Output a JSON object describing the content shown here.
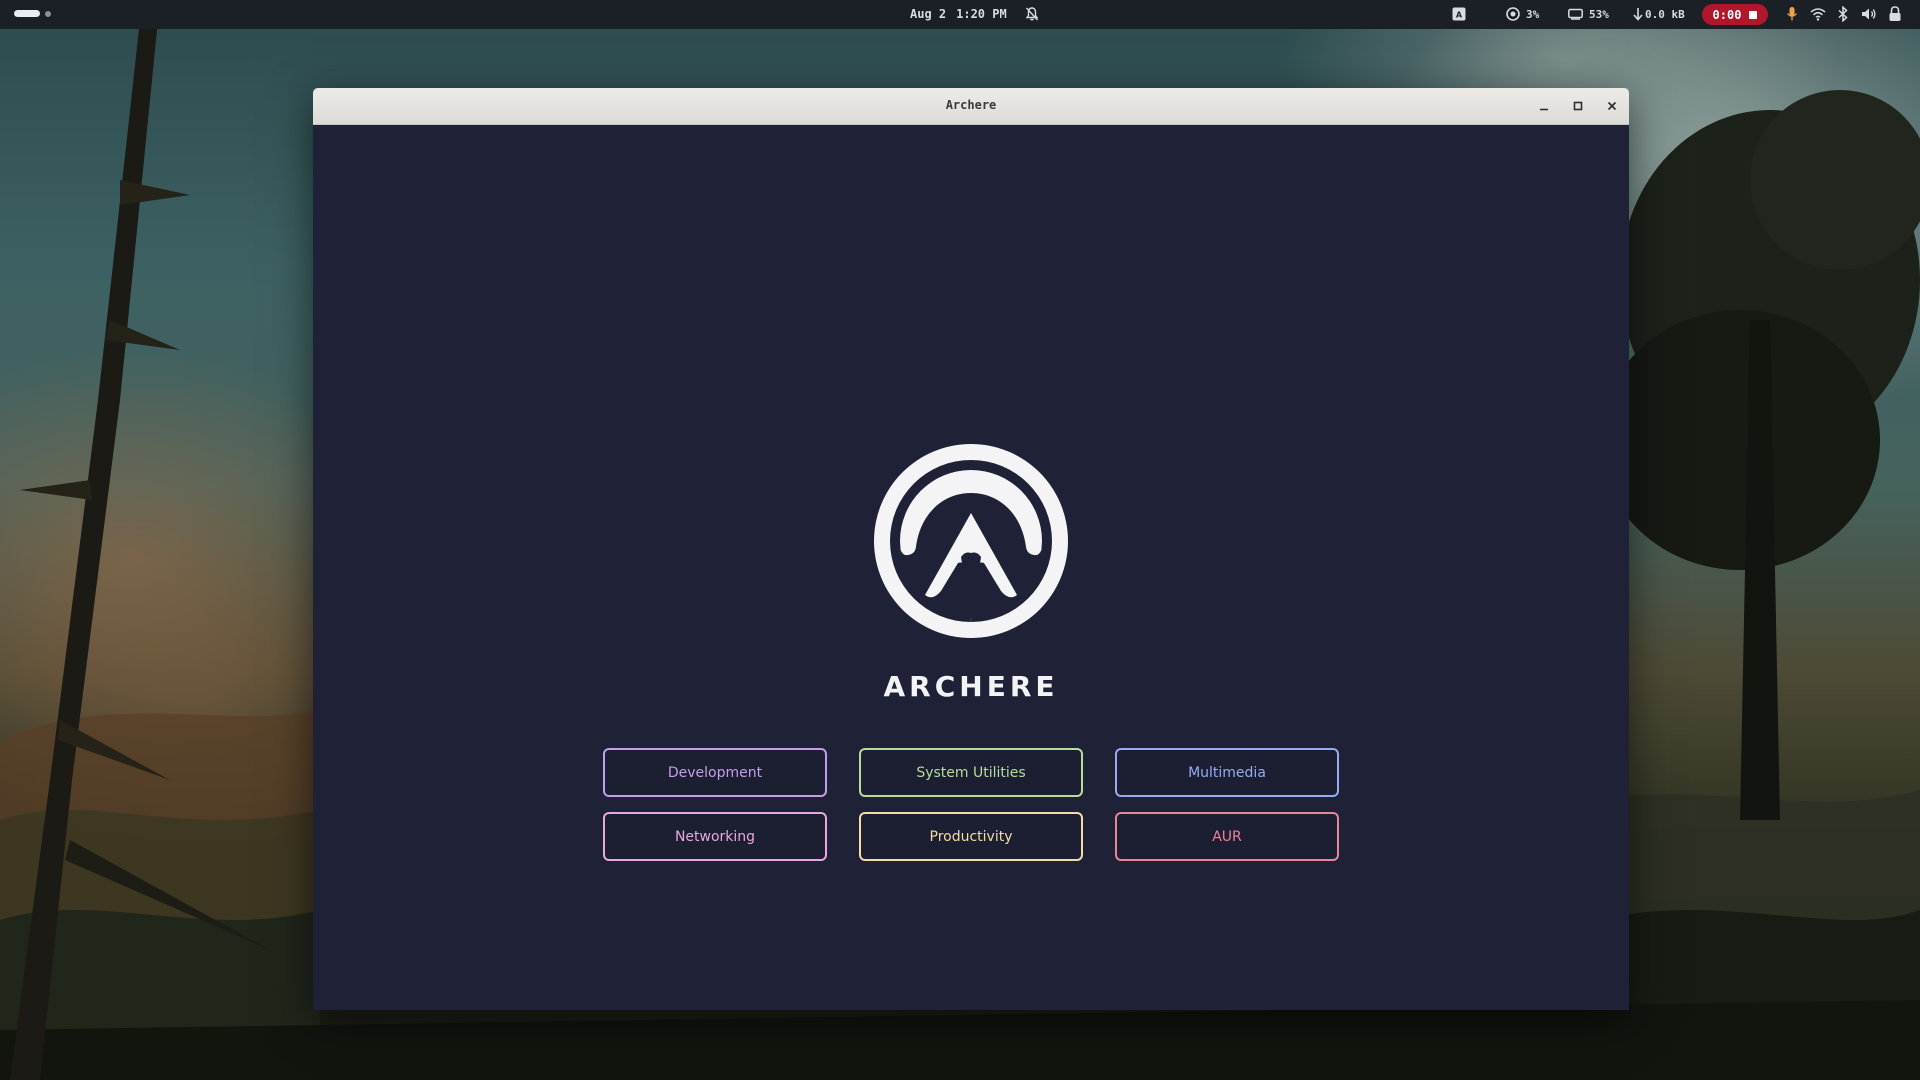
{
  "topbar": {
    "date": "Aug 2",
    "time": "1:20 PM",
    "cpu_label": "3%",
    "memory_label": "53%",
    "network_label": "0.0 kB",
    "recording_label": "0:00"
  },
  "window": {
    "title": "Archere"
  },
  "app": {
    "name": "ARCHERE",
    "categories": [
      {
        "label": "Development",
        "color": "#c39ee8"
      },
      {
        "label": "System Utilities",
        "color": "#b7dd98"
      },
      {
        "label": "Multimedia",
        "color": "#97aaf6"
      },
      {
        "label": "Networking",
        "color": "#e9a6df"
      },
      {
        "label": "Productivity",
        "color": "#f3dda3"
      },
      {
        "label": "AUR",
        "color": "#ec8398"
      }
    ]
  },
  "colors": {
    "window_background": "#1f2136",
    "titlebar": "#e5e3df",
    "topbar": "#1b1f26",
    "recording": "#b0172b"
  }
}
